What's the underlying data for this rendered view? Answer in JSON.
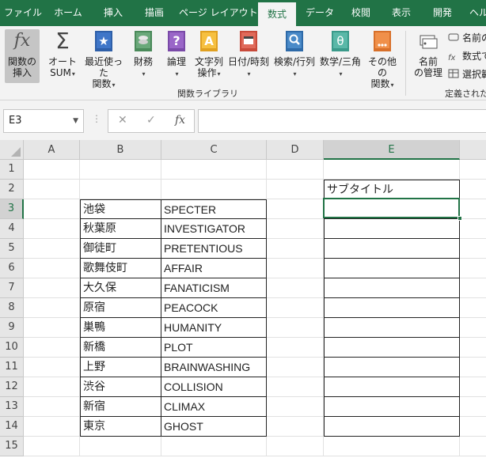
{
  "tabs": [
    "ファイル",
    "ホーム",
    "挿入",
    "描画",
    "ページ レイアウト",
    "数式",
    "データ",
    "校閲",
    "表示",
    "開発",
    "ヘル"
  ],
  "ribbon": {
    "insert_function": [
      "関数の",
      "挿入"
    ],
    "autosum": [
      "オート",
      "SUM"
    ],
    "recent": [
      "最近使った",
      "関数"
    ],
    "financial": "財務",
    "logical": "論理",
    "text": [
      "文字列",
      "操作"
    ],
    "datetime": "日付/時刻",
    "lookup": "検索/行列",
    "math": "数学/三角",
    "more": [
      "その他の",
      "関数"
    ],
    "name_manager": [
      "名前",
      "の管理"
    ],
    "define_name": "名前の",
    "use_in_formula": "数式で",
    "create_from_selection": "選択範",
    "group_label": "関数ライブラリ",
    "group_label2": "定義された"
  },
  "formula_bar": {
    "name_box": "E3",
    "fx": "fx",
    "cancel": "✕",
    "enter": "✓",
    "formula": ""
  },
  "columns": [
    "A",
    "B",
    "C",
    "D",
    "E"
  ],
  "rows": [
    "1",
    "2",
    "3",
    "4",
    "5",
    "6",
    "7",
    "8",
    "9",
    "10",
    "11",
    "12",
    "13",
    "14",
    "15"
  ],
  "subtitle": "サブタイトル",
  "table": [
    [
      "池袋",
      "SPECTER"
    ],
    [
      "秋葉原",
      "INVESTIGATOR"
    ],
    [
      "御徒町",
      "PRETENTIOUS"
    ],
    [
      "歌舞伎町",
      "AFFAIR"
    ],
    [
      "大久保",
      "FANATICISM"
    ],
    [
      "原宿",
      "PEACOCK"
    ],
    [
      "巣鴨",
      "HUMANITY"
    ],
    [
      "新橋",
      "PLOT"
    ],
    [
      "上野",
      "BRAINWASHING"
    ],
    [
      "渋谷",
      "COLLISION"
    ],
    [
      "新宿",
      "CLIMAX"
    ],
    [
      "東京",
      "GHOST"
    ]
  ],
  "colors": {
    "brand": "#217346",
    "grid": "#e1e1e1",
    "border": "#222222"
  }
}
